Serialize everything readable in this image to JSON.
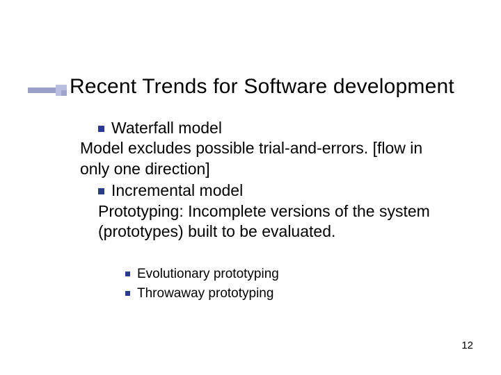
{
  "title": "Recent Trends for Software development",
  "bullets": [
    {
      "heading": "Waterfall model",
      "text": "Model excludes possible trial-and-errors. [flow in only one direction]"
    },
    {
      "heading": "Incremental model",
      "text": "Prototyping: Incomplete versions of the system (prototypes) built to be evaluated."
    }
  ],
  "sub_bullets": [
    "Evolutionary prototyping",
    "Throwaway prototyping"
  ],
  "page_number": "12"
}
